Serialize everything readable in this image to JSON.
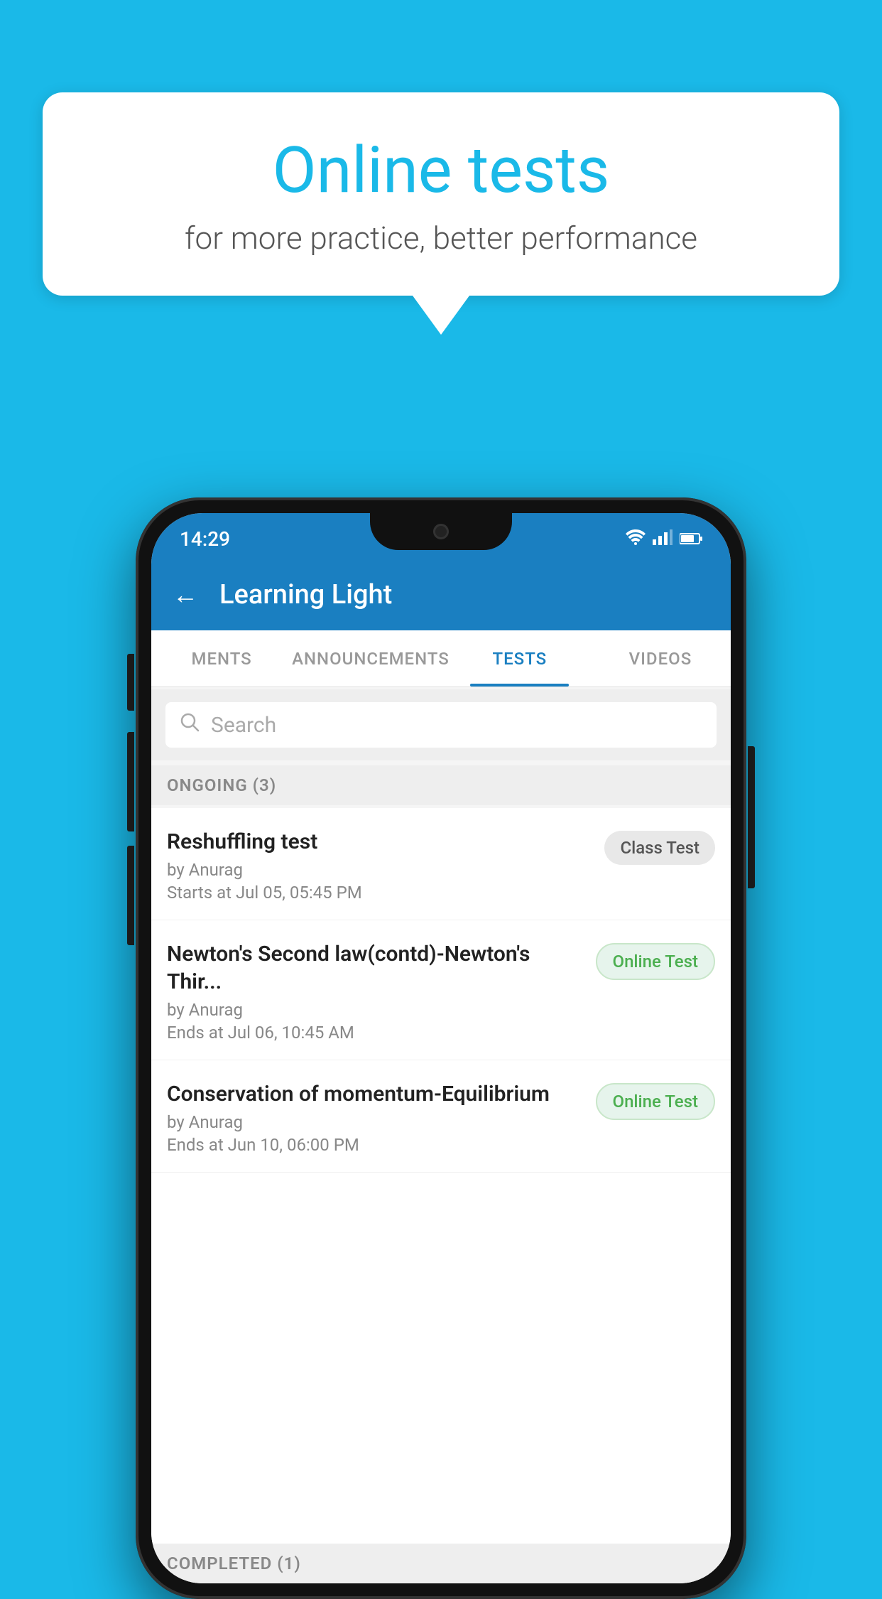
{
  "background_color": "#1ab9e8",
  "speech_bubble": {
    "title": "Online tests",
    "subtitle": "for more practice, better performance"
  },
  "phone": {
    "status_bar": {
      "time": "14:29",
      "icons": [
        "wifi",
        "signal",
        "battery"
      ]
    },
    "app_bar": {
      "back_label": "←",
      "title": "Learning Light"
    },
    "tabs": [
      {
        "label": "MENTS",
        "active": false
      },
      {
        "label": "ANNOUNCEMENTS",
        "active": false
      },
      {
        "label": "TESTS",
        "active": true
      },
      {
        "label": "VIDEOS",
        "active": false
      }
    ],
    "search": {
      "placeholder": "Search"
    },
    "section_ongoing": {
      "label": "ONGOING (3)"
    },
    "tests": [
      {
        "name": "Reshuffling test",
        "by": "by Anurag",
        "date_label": "Starts at",
        "date": "Jul 05, 05:45 PM",
        "badge": "Class Test",
        "badge_type": "class"
      },
      {
        "name": "Newton's Second law(contd)-Newton's Thir...",
        "by": "by Anurag",
        "date_label": "Ends at",
        "date": "Jul 06, 10:45 AM",
        "badge": "Online Test",
        "badge_type": "online"
      },
      {
        "name": "Conservation of momentum-Equilibrium",
        "by": "by Anurag",
        "date_label": "Ends at",
        "date": "Jun 10, 06:00 PM",
        "badge": "Online Test",
        "badge_type": "online"
      }
    ],
    "section_completed": {
      "label": "COMPLETED (1)"
    }
  }
}
